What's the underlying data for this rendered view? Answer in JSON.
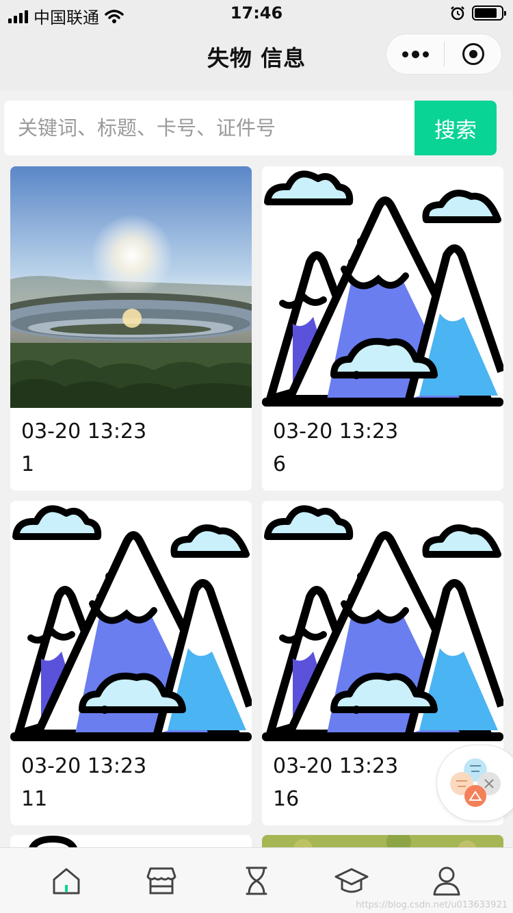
{
  "status_bar": {
    "carrier": "中国联通",
    "time": "17:46",
    "icons": [
      "signal-icon",
      "wifi-icon",
      "alarm-icon",
      "battery-icon"
    ]
  },
  "nav": {
    "title": "失物 信息",
    "icons": [
      "more-icon",
      "close-target-icon"
    ]
  },
  "search": {
    "placeholder": "关键词、标题、卡号、证件号",
    "value": "",
    "button_label": "搜索"
  },
  "cards": [
    {
      "image": "campus-photo",
      "date": "03-20 13:23",
      "id": "1"
    },
    {
      "image": "mountain-illustration",
      "date": "03-20 13:23",
      "id": "6"
    },
    {
      "image": "mountain-illustration",
      "date": "03-20 13:23",
      "id": "11"
    },
    {
      "image": "mountain-illustration",
      "date": "03-20 13:23",
      "id": "16"
    }
  ],
  "tabbar": {
    "items": [
      {
        "icon": "home-icon",
        "active": true
      },
      {
        "icon": "store-icon",
        "active": false
      },
      {
        "icon": "hourglass-icon",
        "active": false
      },
      {
        "icon": "graduation-cap-icon",
        "active": false
      },
      {
        "icon": "user-icon",
        "active": false
      }
    ]
  },
  "colors": {
    "accent": "#0ad396",
    "page_bg": "#f1f1f1",
    "bar_bg": "#ededed"
  },
  "watermark": "https://blog.csdn.net/u013633921"
}
